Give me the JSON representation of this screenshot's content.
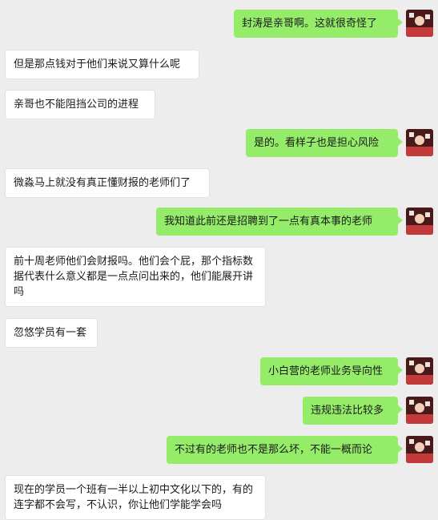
{
  "messages": [
    {
      "side": "out",
      "text": "封涛是亲哥啊。这就很奇怪了"
    },
    {
      "side": "in",
      "text": "但是那点钱对于他们来说又算什么呢"
    },
    {
      "side": "in",
      "text": "亲哥也不能阻挡公司的进程"
    },
    {
      "side": "out",
      "text": "是的。看样子也是担心风险"
    },
    {
      "side": "in",
      "text": "微淼马上就没有真正懂财报的老师们了"
    },
    {
      "side": "out",
      "text": "我知道此前还是招聘到了一点有真本事的老师"
    },
    {
      "side": "in",
      "text": "前十周老师他们会财报吗。他们会个屁，那个指标数据代表什么意义都是一点点问出来的，他们能展开讲吗"
    },
    {
      "side": "in",
      "text": "忽悠学员有一套"
    },
    {
      "side": "out",
      "text": "小白营的老师业务导向性"
    },
    {
      "side": "out",
      "text": "违规违法比较多"
    },
    {
      "side": "out",
      "text": "不过有的老师也不是那么坏，不能一概而论"
    },
    {
      "side": "in",
      "text": "现在的学员一个班有一半以上初中文化以下的，有的连字都不会写，不认识，你让他们学能学会吗"
    }
  ],
  "avatar_icon": "user-avatar-icon",
  "colors": {
    "background": "#ededed",
    "outgoing": "#95ec69",
    "incoming": "#ffffff"
  }
}
